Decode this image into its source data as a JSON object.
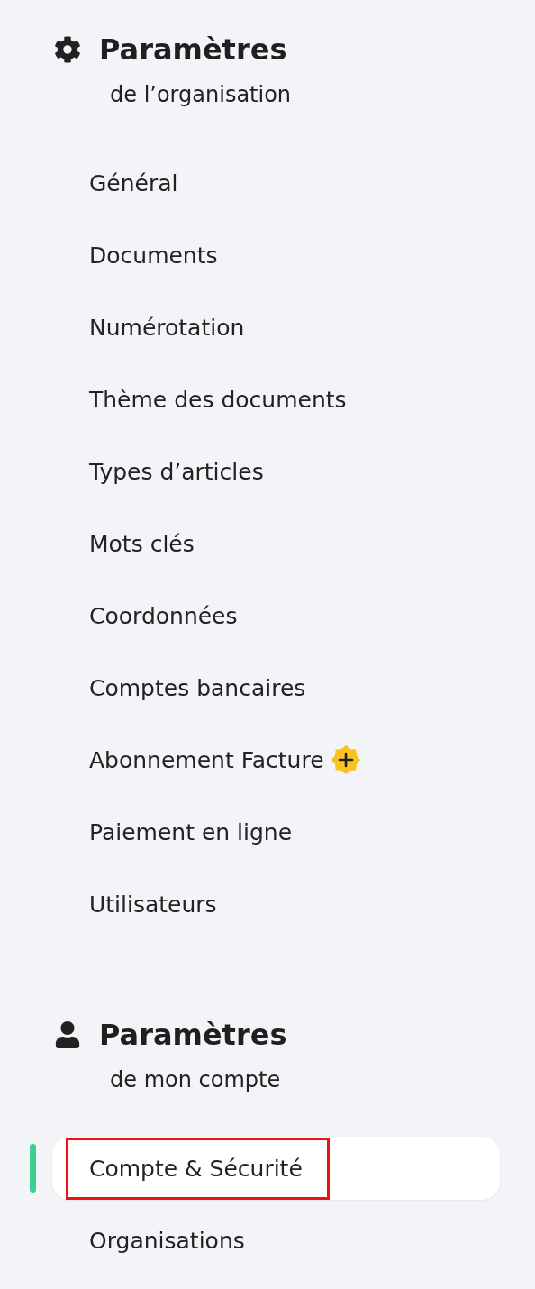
{
  "sections": [
    {
      "kind": "organization",
      "title": "Paramètres",
      "subtitle": "de l’organisation",
      "items": [
        {
          "label": "Général",
          "selected": false
        },
        {
          "label": "Documents",
          "selected": false
        },
        {
          "label": "Numérotation",
          "selected": false
        },
        {
          "label": "Thème des documents",
          "selected": false
        },
        {
          "label": "Types d’articles",
          "selected": false
        },
        {
          "label": "Mots clés",
          "selected": false
        },
        {
          "label": "Coordonnées",
          "selected": false
        },
        {
          "label": "Comptes bancaires",
          "selected": false
        },
        {
          "label": "Abonnement Facture",
          "selected": false,
          "premium": true
        },
        {
          "label": "Paiement en ligne",
          "selected": false
        },
        {
          "label": "Utilisateurs",
          "selected": false
        }
      ]
    },
    {
      "kind": "account",
      "title": "Paramètres",
      "subtitle": "de mon compte",
      "items": [
        {
          "label": "Compte & Sécurité",
          "selected": true,
          "highlighted": true
        },
        {
          "label": "Organisations",
          "selected": false
        }
      ]
    }
  ]
}
